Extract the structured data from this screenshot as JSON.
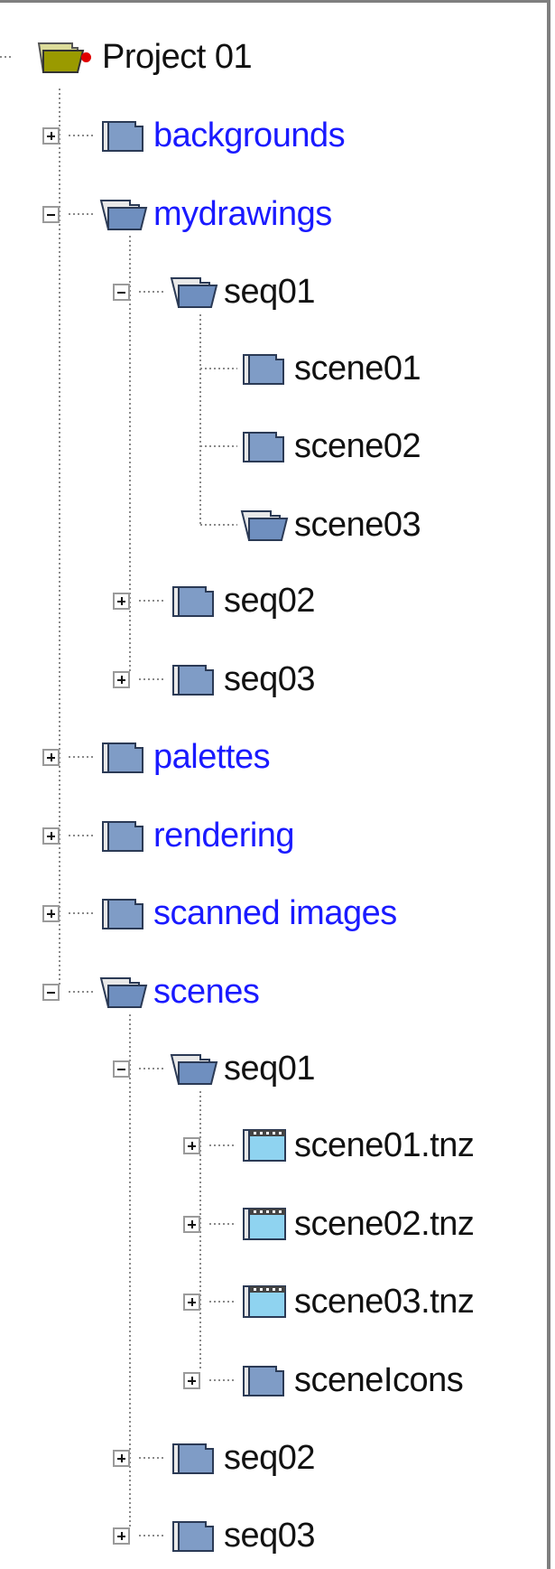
{
  "tree": {
    "root": {
      "label": "Project 01",
      "icon": "project-folder-icon",
      "status_dot_color": "#e00000"
    },
    "nodes": [
      {
        "id": "backgrounds",
        "label": "backgrounds",
        "icon": "folder-icon",
        "expander": "plus",
        "color": "blue"
      },
      {
        "id": "mydrawings",
        "label": "mydrawings",
        "icon": "folder-open-icon",
        "expander": "minus",
        "color": "blue"
      },
      {
        "id": "mydrawings-seq01",
        "label": "seq01",
        "icon": "folder-open-icon",
        "expander": "minus",
        "color": "black"
      },
      {
        "id": "mydrawings-seq01-scene01",
        "label": "scene01",
        "icon": "folder-icon",
        "expander": "none",
        "color": "black"
      },
      {
        "id": "mydrawings-seq01-scene02",
        "label": "scene02",
        "icon": "folder-icon",
        "expander": "none",
        "color": "black"
      },
      {
        "id": "mydrawings-seq01-scene03",
        "label": "scene03",
        "icon": "folder-open-icon",
        "expander": "none",
        "color": "black"
      },
      {
        "id": "mydrawings-seq02",
        "label": "seq02",
        "icon": "folder-icon",
        "expander": "plus",
        "color": "black"
      },
      {
        "id": "mydrawings-seq03",
        "label": "seq03",
        "icon": "folder-icon",
        "expander": "plus",
        "color": "black"
      },
      {
        "id": "palettes",
        "label": "palettes",
        "icon": "folder-icon",
        "expander": "plus",
        "color": "blue"
      },
      {
        "id": "rendering",
        "label": "rendering",
        "icon": "folder-icon",
        "expander": "plus",
        "color": "blue"
      },
      {
        "id": "scanned-images",
        "label": "scanned images",
        "icon": "folder-icon",
        "expander": "plus",
        "color": "blue"
      },
      {
        "id": "scenes",
        "label": "scenes",
        "icon": "folder-open-icon",
        "expander": "minus",
        "color": "blue"
      },
      {
        "id": "scenes-seq01",
        "label": "seq01",
        "icon": "folder-open-icon",
        "expander": "minus",
        "color": "black"
      },
      {
        "id": "scene01-tnz",
        "label": "scene01.tnz",
        "icon": "scene-file-icon",
        "expander": "plus",
        "color": "black"
      },
      {
        "id": "scene02-tnz",
        "label": "scene02.tnz",
        "icon": "scene-file-icon",
        "expander": "plus",
        "color": "black"
      },
      {
        "id": "scene03-tnz",
        "label": "scene03.tnz",
        "icon": "scene-file-icon",
        "expander": "plus",
        "color": "black"
      },
      {
        "id": "sceneicons",
        "label": "sceneIcons",
        "icon": "folder-icon",
        "expander": "plus",
        "color": "black"
      },
      {
        "id": "scenes-seq02",
        "label": "seq02",
        "icon": "folder-icon",
        "expander": "plus",
        "color": "black"
      },
      {
        "id": "scenes-seq03",
        "label": "seq03",
        "icon": "folder-icon",
        "expander": "plus",
        "color": "black"
      }
    ]
  },
  "colors": {
    "link_blue": "#1a1aff",
    "folder_blue": "#7f9cc6",
    "project_olive": "#9a9a00",
    "scene_cyan": "#8fd3f0"
  }
}
